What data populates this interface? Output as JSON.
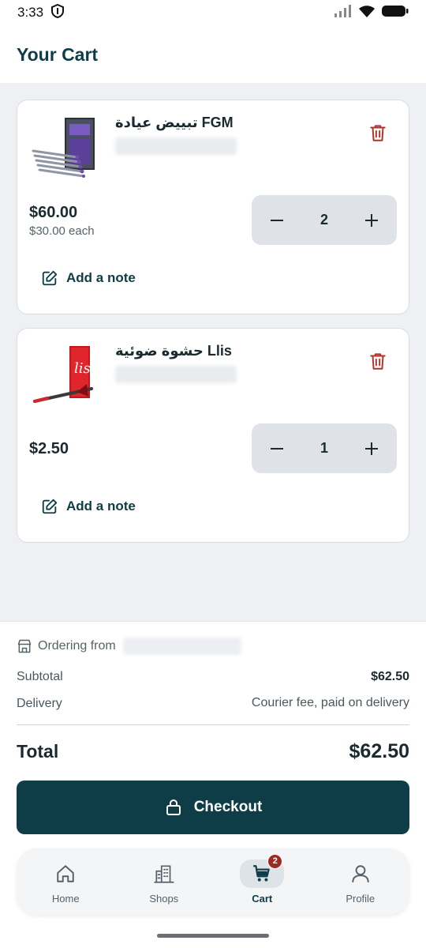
{
  "status_bar": {
    "time": "3:33"
  },
  "header": {
    "title": "Your Cart"
  },
  "cart": {
    "items": [
      {
        "name": "تبييض عيادة FGM",
        "price": "$60.00",
        "unit_price": "$30.00 each",
        "quantity": "2",
        "note_label": "Add a note"
      },
      {
        "name": "حشوة ضوئية Llis",
        "price": "$2.50",
        "quantity": "1",
        "note_label": "Add a note"
      }
    ]
  },
  "summary": {
    "ordering_from_label": "Ordering from",
    "subtotal_label": "Subtotal",
    "subtotal_value": "$62.50",
    "delivery_label": "Delivery",
    "delivery_value": "Courier fee, paid on delivery",
    "total_label": "Total",
    "total_value": "$62.50"
  },
  "checkout": {
    "label": "Checkout"
  },
  "nav": {
    "items": [
      {
        "label": "Home",
        "icon": "home-icon"
      },
      {
        "label": "Shops",
        "icon": "building-icon"
      },
      {
        "label": "Cart",
        "icon": "cart-icon",
        "badge": "2",
        "active": true
      },
      {
        "label": "Profile",
        "icon": "person-icon"
      }
    ]
  },
  "colors": {
    "primary": "#0f3d47",
    "danger": "#9c2b22",
    "background": "#eef0f3"
  }
}
